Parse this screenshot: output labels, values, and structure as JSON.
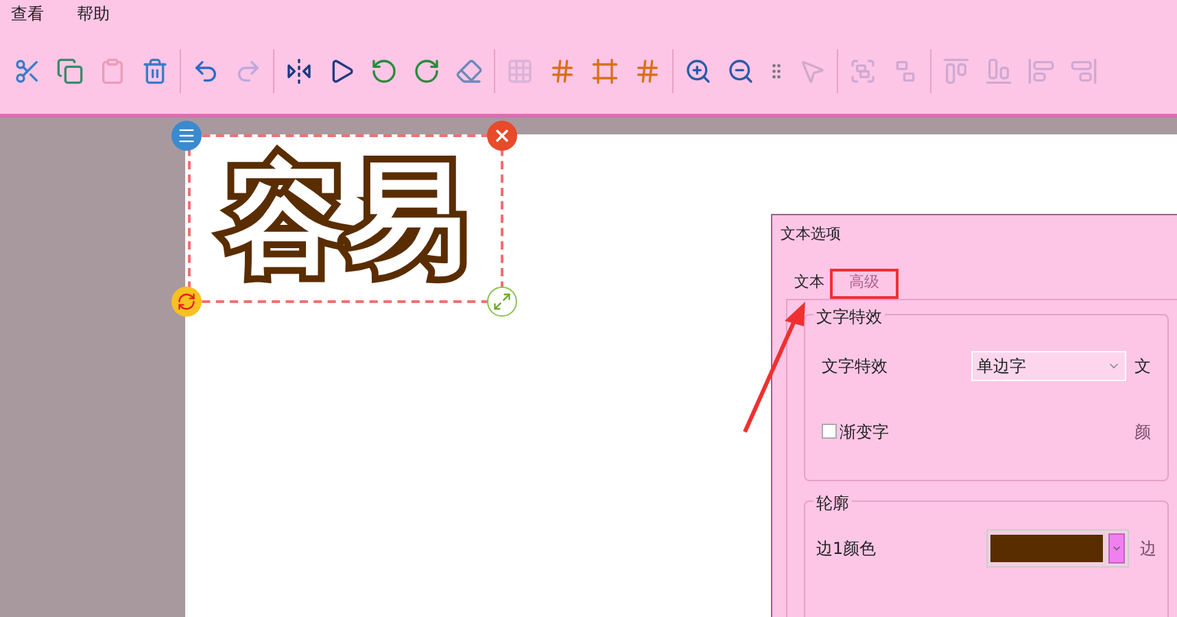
{
  "menu": [
    {
      "label": "查看"
    },
    {
      "label": "帮助"
    }
  ],
  "toolbar": [
    [
      {
        "disabled": false
      },
      {
        "disabled": false
      },
      {
        "disabled": true
      },
      {
        "disabled": false
      }
    ],
    [
      {
        "disabled": false
      },
      {
        "disabled": true
      }
    ],
    [
      {
        "disabled": false
      },
      {
        "disabled": false
      },
      {
        "disabled": false
      },
      {
        "disabled": false
      },
      {
        "disabled": false
      }
    ],
    [
      {
        "disabled": true
      },
      {
        "disabled": false
      },
      {
        "disabled": false
      },
      {
        "disabled": false
      }
    ],
    [
      {
        "disabled": false
      },
      {
        "disabled": false
      },
      {
        "disabled": true
      }
    ],
    [
      {
        "disabled": true
      },
      {
        "disabled": true
      }
    ],
    [
      {
        "disabled": true
      },
      {
        "disabled": true
      },
      {
        "disabled": true
      },
      {
        "disabled": true
      }
    ]
  ],
  "canvas": {
    "text": "容易",
    "selected": true
  },
  "dialog": {
    "title": "文本选项",
    "tabs": [
      {
        "label": "文本",
        "selected": false
      },
      {
        "label": "高级",
        "selected": true
      }
    ],
    "effects_group": {
      "title": "文字特效",
      "label": "文字特效",
      "value": "单边字",
      "side_label": "文",
      "gradient": {
        "label": "渐变字",
        "checked": false
      },
      "gradient_side_label": "颜"
    },
    "outline_group": {
      "title": "轮廓",
      "label": "边1颜色",
      "color": "#5a2d00",
      "side_label": "边"
    }
  }
}
